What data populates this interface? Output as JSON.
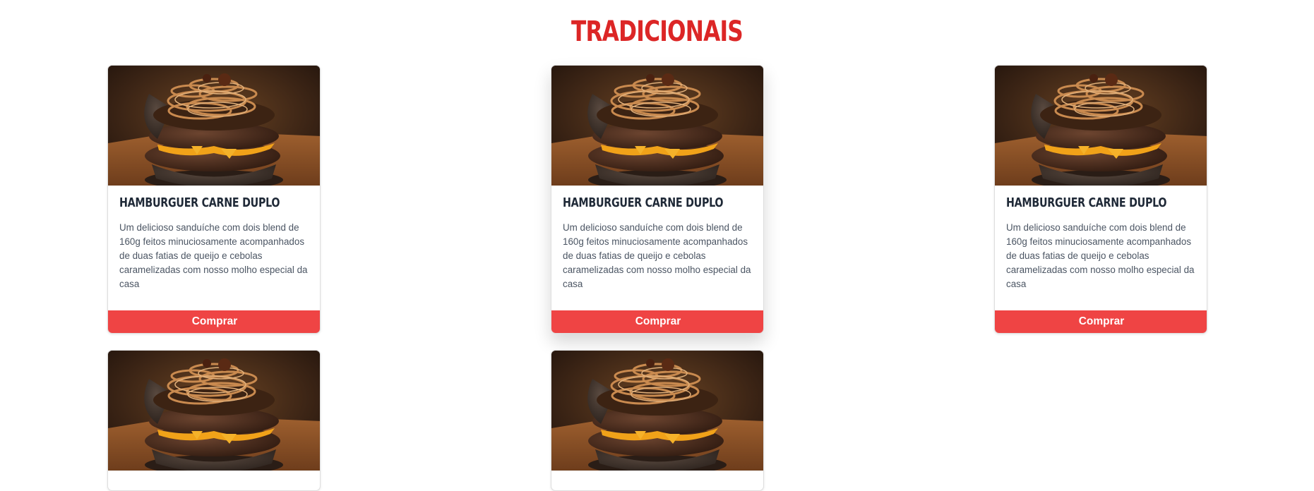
{
  "section": {
    "title": "TRADICIONAIS"
  },
  "products": [
    {
      "name": "HAMBURGUER CARNE DUPLO",
      "description": "Um delicioso sanduíche com dois blend de 160g feitos minuciosamente acompanhados de duas fatias de queijo e cebolas caramelizadas com nosso molho especial da casa",
      "button_label": "Comprar",
      "image": "burger-photo"
    },
    {
      "name": "HAMBURGUER CARNE DUPLO",
      "description": "Um delicioso sanduíche com dois blend de 160g feitos minuciosamente acompanhados de duas fatias de queijo e cebolas caramelizadas com nosso molho especial da casa",
      "button_label": "Comprar",
      "image": "burger-photo"
    },
    {
      "name": "HAMBURGUER CARNE DUPLO",
      "description": "Um delicioso sanduíche com dois blend de 160g feitos minuciosamente acompanhados de duas fatias de queijo e cebolas caramelizadas com nosso molho especial da casa",
      "button_label": "Comprar",
      "image": "burger-photo"
    }
  ],
  "colors": {
    "title": "#dc2626",
    "button": "#ef4444",
    "product_name": "#1f2937",
    "description": "#4b5563"
  }
}
